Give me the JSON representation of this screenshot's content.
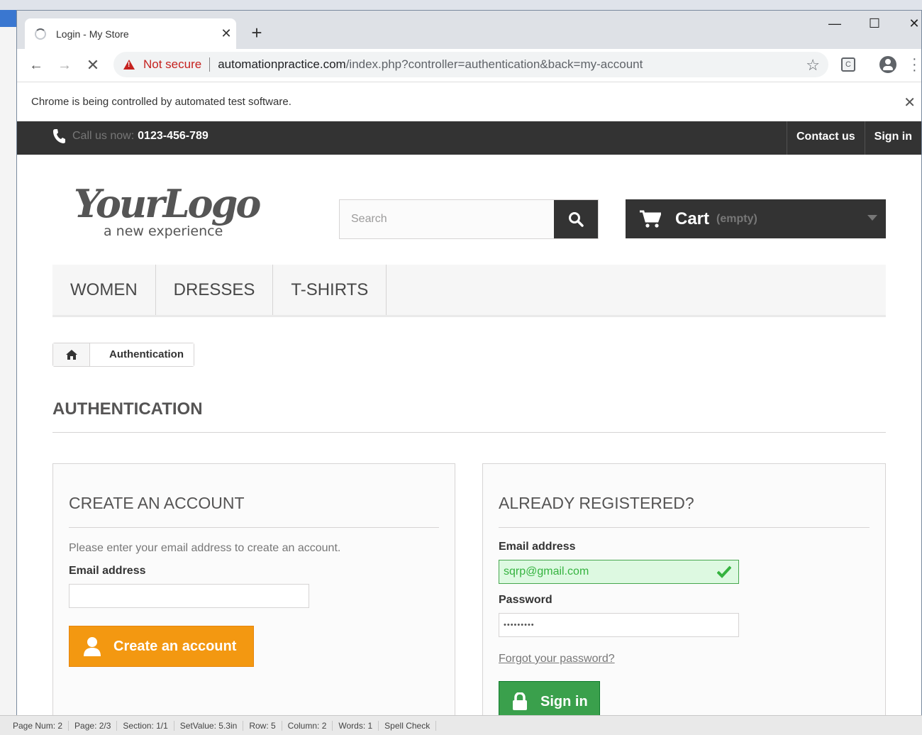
{
  "browser": {
    "tab_title": "Login - My Store",
    "tab_close": "✕",
    "new_tab": "+",
    "not_secure": "Not secure",
    "url_host": "automationpractice.com",
    "url_path": "/index.php?controller=authentication&back=my-account",
    "ext_label": "C",
    "infobar_text": "Chrome is being controlled by automated test software.",
    "infobar_close": "✕",
    "win_minimize": "—",
    "win_maximize": "☐",
    "win_close": "✕"
  },
  "topbar": {
    "call_label": "Call us now:",
    "phone": "0123-456-789",
    "contact": "Contact us",
    "signin": "Sign in"
  },
  "logo": {
    "main": "YourLogo",
    "tagline": "a new experience"
  },
  "search": {
    "placeholder": "Search"
  },
  "cart": {
    "label": "Cart",
    "status": "(empty)"
  },
  "menu": {
    "items": [
      "WOMEN",
      "DRESSES",
      "T-SHIRTS"
    ]
  },
  "breadcrumb": {
    "current": "Authentication"
  },
  "heading": "AUTHENTICATION",
  "create_account": {
    "title": "CREATE AN ACCOUNT",
    "intro": "Please enter your email address to create an account.",
    "email_label": "Email address",
    "email_value": "",
    "button": "Create an account"
  },
  "registered": {
    "title": "ALREADY REGISTERED?",
    "email_label": "Email address",
    "email_value": "sqrp@gmail.com",
    "password_label": "Password",
    "password_value": "•••••••••",
    "forgot": "Forgot your password?",
    "button": "Sign in"
  },
  "statusbar": {
    "items": [
      "Page Num: 2",
      "Page: 2/3",
      "Section: 1/1",
      "SetValue: 5.3in",
      "Row: 5",
      "Column: 2",
      "Words: 1",
      "Spell Check"
    ]
  },
  "colors": {
    "accent_orange": "#f39811",
    "accent_green": "#3aa04c",
    "topbar": "#333333",
    "not_secure_red": "#c5221f"
  }
}
